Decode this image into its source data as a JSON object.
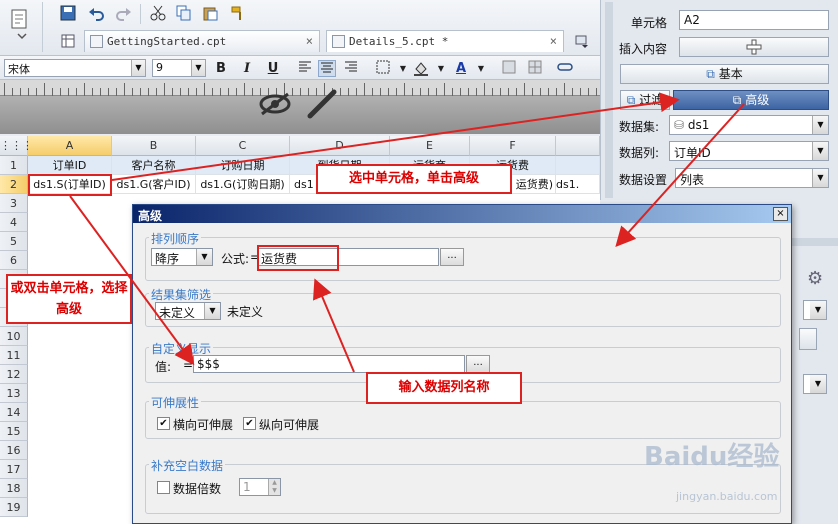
{
  "toolbar": {
    "tabs": [
      {
        "label": "GettingStarted.cpt",
        "close": "×"
      },
      {
        "label": "Details_5.cpt *",
        "close": "×"
      }
    ],
    "font_name": "宋体",
    "font_size": "9",
    "bold": "B",
    "italic": "I",
    "underline": "U",
    "text_color_letter": "A"
  },
  "grid": {
    "columns": [
      "A",
      "B",
      "C",
      "D",
      "E",
      "F"
    ],
    "rows": [
      "1",
      "2",
      "3",
      "4",
      "5",
      "6",
      "7",
      "8",
      "9",
      "10",
      "11",
      "12",
      "13",
      "14",
      "15",
      "16",
      "17",
      "18",
      "19"
    ],
    "row1": [
      "订单ID",
      "客户名称",
      "订购日期",
      "到货日期",
      "运货商",
      "运货费"
    ],
    "row2": [
      "ds1.S(订单ID)",
      "ds1.G(客户ID)",
      "ds1.G(订购日期)",
      "ds1",
      "",
      "运货费)",
      "ds1."
    ]
  },
  "right_panel": {
    "cell_label": "单元格",
    "cell_value": "A2",
    "insert_label": "插入内容",
    "basic_button": "基本",
    "filter_button": "过滤",
    "advanced_button": "高级",
    "dataset_label": "数据集:",
    "dataset_value": "ds1",
    "column_label": "数据列:",
    "column_value": "订单ID",
    "setting_label": "数据设置",
    "setting_value": "列表"
  },
  "dialog": {
    "title": "高级",
    "close": "×",
    "sort_group": "排列顺序",
    "sort_value": "降序",
    "formula_label": "公式:",
    "formula_eq": "=",
    "formula_value": "运货费",
    "dots": "...",
    "filter_group": "结果集筛选",
    "filter_value": "未定义",
    "filter_text": "未定义",
    "custom_group": "自定义显示",
    "custom_label": "值:",
    "custom_eq": "=",
    "custom_value": "$$$",
    "expand_group": "可伸展性",
    "expand_h": "横向可伸展",
    "expand_v": "纵向可伸展",
    "fill_group": "补充空白数据",
    "fill_label": "数据倍数",
    "fill_value": "1"
  },
  "callouts": {
    "select_cell": "选中单元格，单击高级",
    "double_click": "或双击单元格，选择高级",
    "input_column": "输入数据列名称"
  },
  "watermark": {
    "logo": "Baidu经验",
    "url": "jingyan.baidu.com"
  },
  "colors": {
    "accent": "#d22222",
    "dialog_title": "#0a246a",
    "group_title": "#3a7ac8"
  }
}
